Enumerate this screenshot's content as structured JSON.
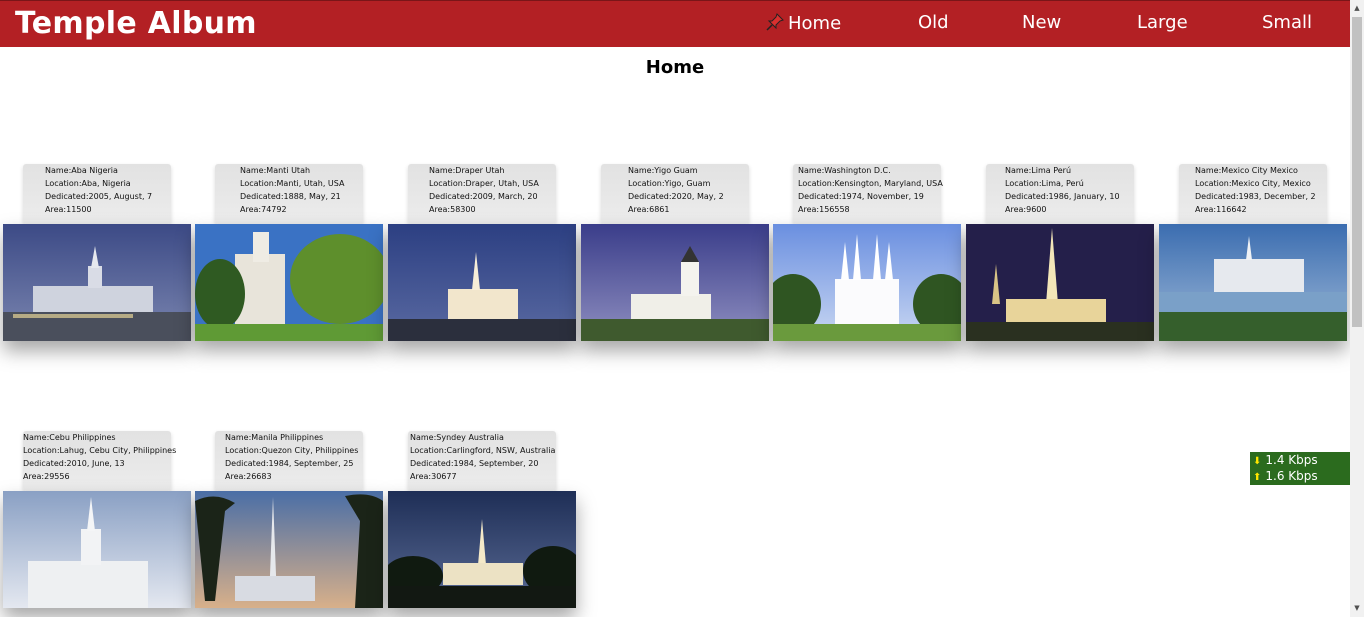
{
  "header": {
    "brand": "Temple Album",
    "nav": [
      "Home",
      "Old",
      "New",
      "Large",
      "Small"
    ],
    "pin_icon": "pushpin-icon"
  },
  "page": {
    "title": "Home"
  },
  "temples": [
    {
      "name": "Name:Aba Nigeria",
      "location": "Location:Aba, Nigeria",
      "dedicated": "Dedicated:2005, August, 7",
      "area": "Area:11500"
    },
    {
      "name": "Name:Manti Utah",
      "location": "Location:Manti, Utah, USA",
      "dedicated": "Dedicated:1888, May, 21",
      "area": "Area:74792"
    },
    {
      "name": "Name:Draper Utah",
      "location": "Location:Draper, Utah, USA",
      "dedicated": "Dedicated:2009, March, 20",
      "area": "Area:58300"
    },
    {
      "name": "Name:Yigo Guam",
      "location": "Location:Yigo, Guam",
      "dedicated": "Dedicated:2020, May, 2",
      "area": "Area:6861"
    },
    {
      "name": "Name:Washington D.C.",
      "location": "Location:Kensington, Maryland, USA",
      "dedicated": "Dedicated:1974, November, 19",
      "area": "Area:156558"
    },
    {
      "name": "Name:Lima Perú",
      "location": "Location:Lima, Perú",
      "dedicated": "Dedicated:1986, January, 10",
      "area": "Area:9600"
    },
    {
      "name": "Name:Mexico City Mexico",
      "location": "Location:Mexico City, Mexico",
      "dedicated": "Dedicated:1983, December, 2",
      "area": "Area:116642"
    },
    {
      "name": "Name:Cebu Philippines",
      "location": "Location:Lahug, Cebu City, Philippines",
      "dedicated": "Dedicated:2010, June, 13",
      "area": "Area:29556"
    },
    {
      "name": "Name:Manila Philippines",
      "location": "Location:Quezon City, Philippines",
      "dedicated": "Dedicated:1984, September, 25",
      "area": "Area:26683"
    },
    {
      "name": "Name:Syndey Australia",
      "location": "Location:Carlingford, NSW, Australia",
      "dedicated": "Dedicated:1984, September, 20",
      "area": "Area:30677"
    }
  ],
  "netmeter": {
    "down": "1.4 Kbps",
    "up": "1.6 Kbps"
  },
  "colors": {
    "header": "#b32024",
    "netmeter": "#2b6b1e"
  }
}
